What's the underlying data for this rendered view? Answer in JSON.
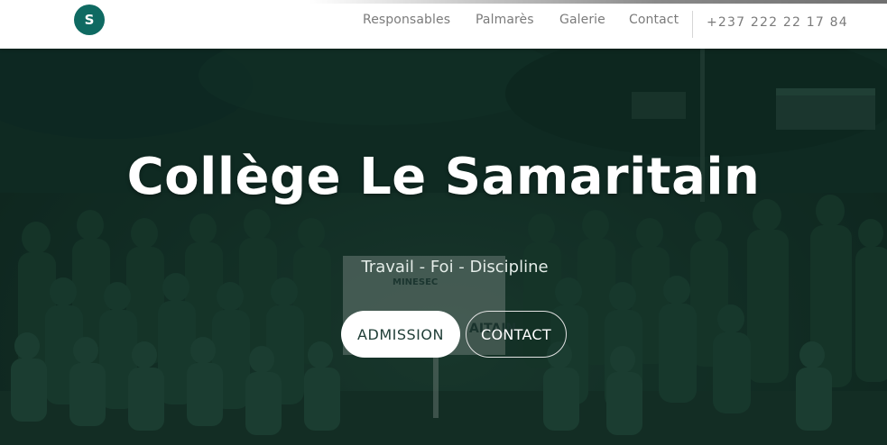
{
  "header": {
    "logo_letter": "S",
    "nav": [
      "Responsables",
      "Palmarès",
      "Galerie",
      "Contact"
    ],
    "phone": "+237 222 22 17 84"
  },
  "hero": {
    "title": "Collège Le Samaritain",
    "tagline": "Travail - Foi - Discipline",
    "admission_label": "ADMISSION",
    "contact_label": "CONTACT",
    "sign_text_1": "MINESEC",
    "sign_text_2": "AITAIN"
  },
  "colors": {
    "brand_teal": "#0f6a62",
    "hero_overlay": "#102820",
    "nav_text": "#7b7b7b"
  }
}
